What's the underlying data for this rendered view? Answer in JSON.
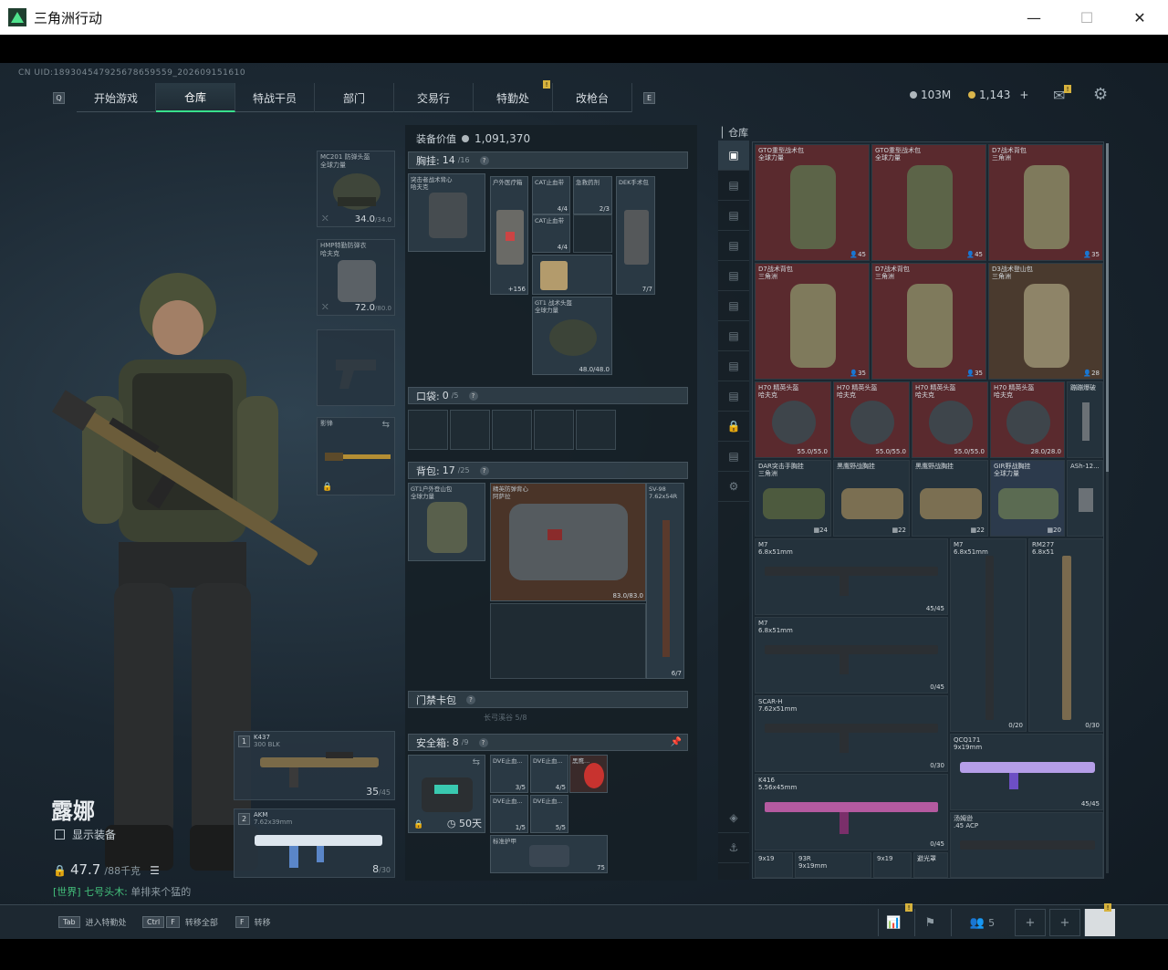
{
  "window": {
    "title": "三角洲行动",
    "minimize": "—",
    "maximize": "☐",
    "close": "✕"
  },
  "uid": "CN UID:1893045479256786595​59_202609151610",
  "nav": {
    "left_key": "Q",
    "right_key": "E",
    "tabs": [
      "开始游戏",
      "仓库",
      "特战干员",
      "部门",
      "交易行",
      "特勤处",
      "改枪台"
    ],
    "active": "仓库"
  },
  "currency": {
    "silver": "103M",
    "gold": "1,143",
    "plus": "+"
  },
  "character": {
    "name": "露娜",
    "show_equipment": "显示装备",
    "weight": "47.7",
    "weight_max": "/88千克",
    "chat_channel": "[世界] 七号头木:",
    "chat_text": " 单排来个猛的"
  },
  "slots": {
    "helmet": {
      "label": "MC201 防弹头盔",
      "sub": "全球力量",
      "value": "34.0",
      "max": "/34.0"
    },
    "armor": {
      "label": "HMP特勤防弹衣",
      "sub": "哈夫克",
      "value": "72.0",
      "max": "/80.0"
    },
    "melee": {
      "label": "影锋"
    },
    "primary": {
      "num": "1",
      "label": "K437",
      "sub": "300 BLK",
      "ammo": "35",
      "ammo_max": "/45"
    },
    "secondary": {
      "num": "2",
      "label": "AKM",
      "sub": "7.62x39mm",
      "ammo": "8",
      "ammo_max": "/30"
    }
  },
  "equipment": {
    "value_label": "装备价值",
    "value": "1,091,370",
    "chest": {
      "title": "胸挂:",
      "count": "14",
      "max": "/16"
    },
    "chest_items": [
      {
        "label": "突击者战术背心",
        "sub": "哈夫克",
        "val": ""
      },
      {
        "label": "户外医疗箱",
        "sub": "",
        "val": "+156"
      },
      {
        "label": "CAT止血带",
        "sub": "",
        "val": "4/4"
      },
      {
        "label": "急救药剂",
        "sub": "",
        "val": "2/3"
      },
      {
        "label": "DEK手术包",
        "sub": "",
        "val": "7/7"
      },
      {
        "label": "CAT止血带",
        "sub": "",
        "val": "4/4"
      },
      {
        "label": "GT1 战术头盔",
        "sub": "全球力量",
        "val": "48.0/48.0"
      }
    ],
    "pocket": {
      "title": "口袋:",
      "count": "0",
      "max": "/5"
    },
    "backpack": {
      "title": "背包:",
      "count": "17",
      "max": "/25"
    },
    "backpack_items": [
      {
        "label": "GT1户外登山包",
        "sub": "全球力量",
        "val": ""
      },
      {
        "label": "精英防弹背心",
        "sub": "阿萨拉",
        "val": "83.0/83.0"
      },
      {
        "label": "SV-98",
        "sub": "7.62x54R",
        "val": "6/7"
      }
    ],
    "keycard": {
      "title": "门禁卡包",
      "sub": "长弓溪谷 5/8"
    },
    "safebox": {
      "title": "安全箱:",
      "count": "8",
      "max": "/9",
      "days": "50天"
    },
    "safe_items": [
      {
        "label": "DVE止血...",
        "val": "3/5"
      },
      {
        "label": "DVE止血...",
        "val": "4/5"
      },
      {
        "label": "黑鹰...",
        "val": ""
      },
      {
        "label": "DVE止血...",
        "val": "1/5"
      },
      {
        "label": "DVE止血...",
        "val": "5/5"
      },
      {
        "label": "标准护甲",
        "val": "75"
      }
    ]
  },
  "warehouse": {
    "title": "仓库",
    "items": [
      {
        "label": "GTO重型战术包",
        "sub": "全球力量",
        "val": "45"
      },
      {
        "label": "GTO重型战术包",
        "sub": "全球力量",
        "val": "45"
      },
      {
        "label": "D7战术背包",
        "sub": "三角洲",
        "val": "35"
      },
      {
        "label": "D7战术背包",
        "sub": "三角洲",
        "val": "35"
      },
      {
        "label": "D7战术背包",
        "sub": "三角洲",
        "val": "35"
      },
      {
        "label": "D3战术登山包",
        "sub": "三角洲",
        "val": "28"
      },
      {
        "label": "H70 精英头盔",
        "sub": "哈夫克",
        "val": "55.0/55.0"
      },
      {
        "label": "H70 精英头盔",
        "sub": "哈夫克",
        "val": "55.0/55.0"
      },
      {
        "label": "H70 精英头盔",
        "sub": "哈夫克",
        "val": "55.0/55.0"
      },
      {
        "label": "H70 精英头盔",
        "sub": "哈夫克",
        "val": "28.0/28.0"
      },
      {
        "label": "蹦蹦爆破",
        "sub": "",
        "val": ""
      },
      {
        "label": "DAR突击手胸挂",
        "sub": "三角洲",
        "val": "24"
      },
      {
        "label": "黑鹰野战胸挂",
        "sub": "",
        "val": "22"
      },
      {
        "label": "黑鹰野战胸挂",
        "sub": "",
        "val": "22"
      },
      {
        "label": "GIR野战胸挂",
        "sub": "全球力量",
        "val": "20"
      },
      {
        "label": "ASh-12...",
        "sub": "",
        "val": ""
      },
      {
        "label": "M7",
        "sub": "6.8x51mm",
        "val": "45/45"
      },
      {
        "label": "M7",
        "sub": "6.8x51mm",
        "val": "0/20"
      },
      {
        "label": "RM277",
        "sub": "6.8x51",
        "val": "0/30"
      },
      {
        "label": "M7",
        "sub": "6.8x51mm",
        "val": "0/45"
      },
      {
        "label": "SCAR-H",
        "sub": "7.62x51mm",
        "val": "0/30"
      },
      {
        "label": "QCQ171",
        "sub": "9x19mm",
        "val": "45/45"
      },
      {
        "label": "K416",
        "sub": "5.56x45mm",
        "val": "0/45"
      },
      {
        "label": "汤姆逊",
        "sub": ".45 ACP",
        "val": ""
      },
      {
        "label": "9x19",
        "sub": "",
        "val": ""
      },
      {
        "label": "93R",
        "sub": "9x19mm",
        "val": ""
      },
      {
        "label": "9x19",
        "sub": "",
        "val": ""
      },
      {
        "label": "避光罩",
        "sub": "",
        "val": ""
      }
    ]
  },
  "bottom": {
    "hint1_key": "Tab",
    "hint1": "进入特勤处",
    "hint2_key": "Ctrl",
    "hint2_key2": "F",
    "hint2": "转移全部",
    "hint3_key": "F",
    "hint3": "转移",
    "squad": "5"
  },
  "colors": {
    "accent": "#38e08c",
    "badge": "#d6b23d"
  }
}
